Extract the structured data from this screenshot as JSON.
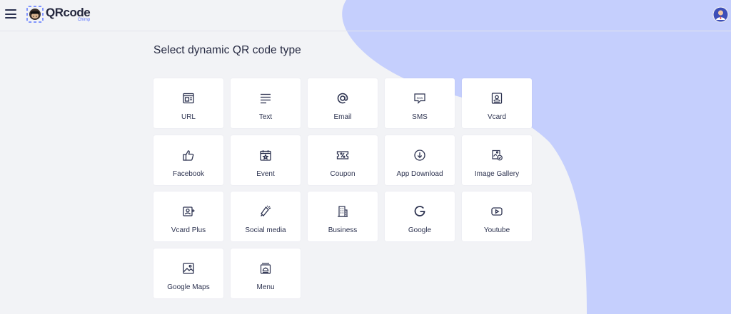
{
  "header": {
    "logo_name": "QRcode",
    "logo_sub": "Chimp",
    "menu_icon": "hamburger-icon",
    "avatar_icon": "user-avatar-icon"
  },
  "page": {
    "title": "Select dynamic QR code type"
  },
  "qr_types": [
    {
      "label": "URL",
      "icon": "browser-window-icon"
    },
    {
      "label": "Text",
      "icon": "text-lines-icon"
    },
    {
      "label": "Email",
      "icon": "at-sign-icon"
    },
    {
      "label": "SMS",
      "icon": "sms-bubble-icon"
    },
    {
      "label": "Vcard",
      "icon": "contact-card-icon"
    },
    {
      "label": "Facebook",
      "icon": "thumbs-up-icon"
    },
    {
      "label": "Event",
      "icon": "calendar-star-icon"
    },
    {
      "label": "Coupon",
      "icon": "coupon-ticket-icon"
    },
    {
      "label": "App Download",
      "icon": "download-circle-icon"
    },
    {
      "label": "Image Gallery",
      "icon": "gallery-check-icon"
    },
    {
      "label": "Vcard Plus",
      "icon": "contact-plus-icon"
    },
    {
      "label": "Social media",
      "icon": "megaphone-icon"
    },
    {
      "label": "Business",
      "icon": "building-icon"
    },
    {
      "label": "Google",
      "icon": "google-g-icon"
    },
    {
      "label": "Youtube",
      "icon": "play-button-icon"
    },
    {
      "label": "Google Maps",
      "icon": "map-image-icon"
    },
    {
      "label": "Menu",
      "icon": "menu-book-icon"
    }
  ],
  "colors": {
    "page_bg": "#f2f3f6",
    "blob": "#c5cffd",
    "card_bg": "#ffffff",
    "text": "#2b3150",
    "accent": "#5b74ff"
  }
}
